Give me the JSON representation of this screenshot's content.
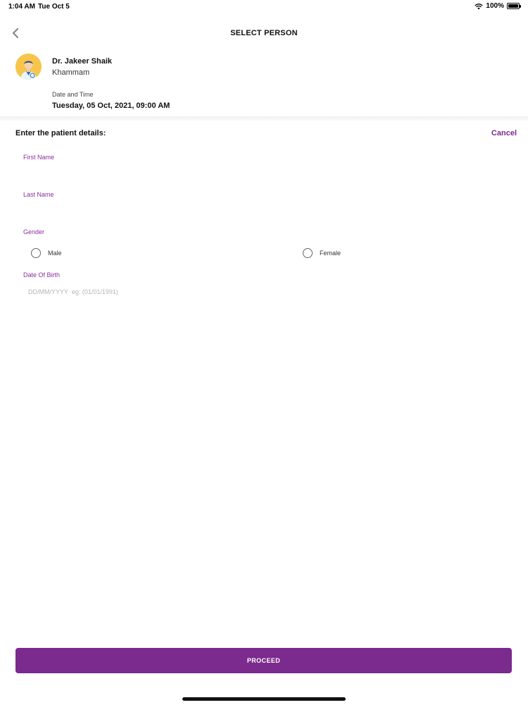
{
  "status": {
    "time": "1:04 AM",
    "date": "Tue Oct 5",
    "battery": "100%"
  },
  "nav": {
    "title": "SELECT PERSON"
  },
  "doctor": {
    "name": "Dr. Jakeer Shaik",
    "location": "Khammam",
    "datetime_label": "Date and Time",
    "datetime_value": "Tuesday, 05 Oct, 2021, 09:00 AM"
  },
  "form": {
    "title": "Enter the patient details:",
    "cancel_label": "Cancel",
    "first_name_label": "First Name",
    "first_name_value": "",
    "last_name_label": "Last Name",
    "last_name_value": "",
    "gender_label": "Gender",
    "gender_options": [
      "Male",
      "Female"
    ],
    "dob_label": "Date Of Birth",
    "dob_placeholder": "DD/MM/YYYY  eg: (01/01/1991)"
  },
  "proceed_label": "PROCEED",
  "colors": {
    "accent": "#7b2a8e",
    "avatar_bg": "#f6c54a"
  }
}
